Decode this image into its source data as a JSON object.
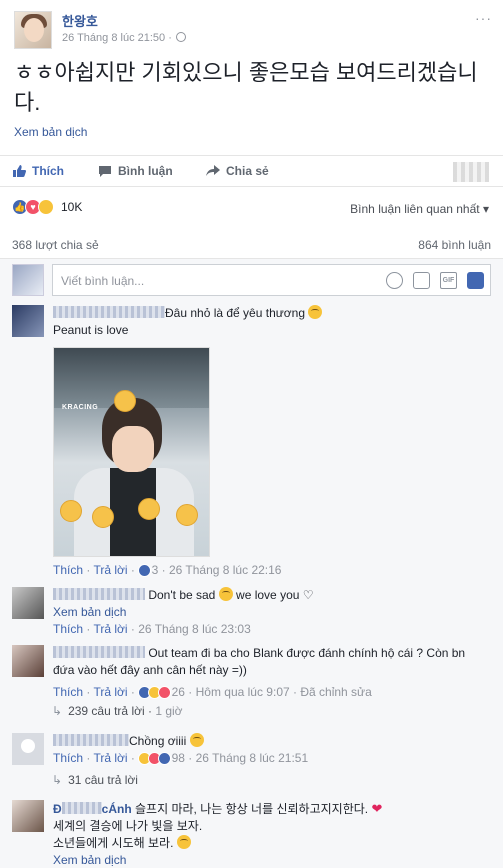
{
  "post": {
    "author": "한왕호",
    "timestamp": "26 Tháng 8 lúc 21:50 ·",
    "text": "ㅎㅎ아쉽지만 기회있으니 좋은모습 보여드리겠습니다.",
    "see_translation": "Xem bản dịch"
  },
  "actions": {
    "like": "Thích",
    "comment": "Bình luận",
    "share": "Chia sẻ"
  },
  "reactions": {
    "count": "10K",
    "sort_label": "Bình luận liên quan nhất",
    "shares": "368 lượt chia sẻ",
    "comments_count": "864 bình luận"
  },
  "composer": {
    "placeholder": "Viết bình luận..."
  },
  "comments": [
    {
      "text": "Đâu nhỏ là để yêu thương",
      "line2": "Peanut is love",
      "photo_tag": "KRACING",
      "like": "Thích",
      "reply": "Trả lời",
      "react_count": "3",
      "time": "26 Tháng 8 lúc 22:16"
    },
    {
      "text_a": "Don't be sad",
      "text_b": "we love you ♡",
      "see_translation": "Xem bản dịch",
      "like": "Thích",
      "reply": "Trả lời",
      "time": "26 Tháng 8 lúc 23:03"
    },
    {
      "text": "Out team đi ba cho Blank được đánh chính hộ cái ? Còn bn đứa vào hết đây anh cân hết này =))",
      "like": "Thích",
      "reply": "Trả lời",
      "react_count": "26",
      "time": "Hôm qua lúc 9:07",
      "edited": "Đã chỉnh sửa",
      "replies": "239 câu trả lời",
      "replies_time": "1 giờ"
    },
    {
      "text": "Chồng ơiiii",
      "like": "Thích",
      "reply": "Trả lời",
      "react_count": "98",
      "time": "26 Tháng 8 lúc 21:51",
      "replies": "31 câu trả lời"
    },
    {
      "name_start": "Đ",
      "name_end": "cÁnh",
      "line1": "슬프지 마라, 나는 항상 너를 신뢰하고지지한다.",
      "line2": "세계의 결승에 나가 빛을 보자.",
      "line3": "소년들에게 시도해 보라.",
      "see_translation": "Xem bản dịch"
    }
  ],
  "colors": {
    "link": "#365899",
    "like_blue": "#4267b2",
    "love_red": "#f25268",
    "meta_gray": "#90949c"
  }
}
